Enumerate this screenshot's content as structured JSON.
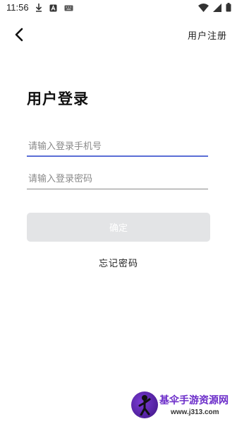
{
  "status_bar": {
    "time": "11:56",
    "icons": [
      "download-icon",
      "a-icon",
      "keyboard-icon",
      "wifi-icon",
      "signal-icon",
      "battery-icon"
    ]
  },
  "header": {
    "back_icon": "back-arrow-icon",
    "register_label": "用户注册"
  },
  "page_title": "用户登录",
  "form": {
    "phone_placeholder": "请输入登录手机号",
    "phone_value": "",
    "password_placeholder": "请输入登录密码",
    "password_value": "",
    "confirm_label": "确定",
    "forgot_label": "忘记密码"
  },
  "watermark": {
    "title": "基伞手游资源网",
    "url": "www.j313.com"
  },
  "colors": {
    "accent": "#5b6ed6",
    "button_disabled": "#e3e4e6",
    "watermark_purple": "#6b2cc9"
  }
}
